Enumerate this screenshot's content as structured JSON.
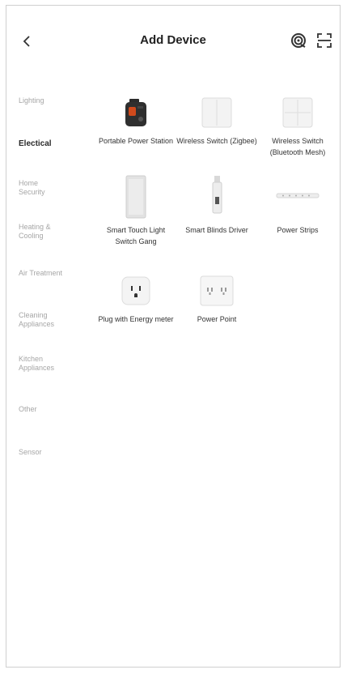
{
  "header": {
    "title": "Add Device",
    "back_icon": "chevron-left-icon",
    "icons": [
      "auto-scan-icon",
      "qr-scan-icon"
    ]
  },
  "sidebar": {
    "items": [
      {
        "label": "Lighting",
        "active": false
      },
      {
        "label": "Electical",
        "active": true
      },
      {
        "label": "Home Security",
        "active": false
      },
      {
        "label": "Heating & Cooling",
        "active": false
      },
      {
        "label": "Air Treatment",
        "active": false
      },
      {
        "label": "Cleaning Appliances",
        "active": false
      },
      {
        "label": "Kitchen Appliances",
        "active": false
      },
      {
        "label": "Other",
        "active": false
      },
      {
        "label": "Sensor",
        "active": false
      }
    ]
  },
  "devices": [
    {
      "label": "Portable Power Station",
      "icon": "portable-power-station-icon"
    },
    {
      "label": "Wireless Switch (Zigbee)",
      "icon": "wireless-switch-zigbee-icon"
    },
    {
      "label": "Wireless Switch (Bluetooth Mesh)",
      "icon": "wireless-switch-bluetooth-icon"
    },
    {
      "label": "Smart Touch Light Switch Gang",
      "icon": "touch-light-switch-icon"
    },
    {
      "label": "Smart Blinds Driver",
      "icon": "blinds-driver-icon"
    },
    {
      "label": "Power Strips",
      "icon": "power-strip-icon"
    },
    {
      "label": "Plug with Energy meter",
      "icon": "energy-plug-icon"
    },
    {
      "label": "Power Point",
      "icon": "power-point-icon"
    }
  ]
}
